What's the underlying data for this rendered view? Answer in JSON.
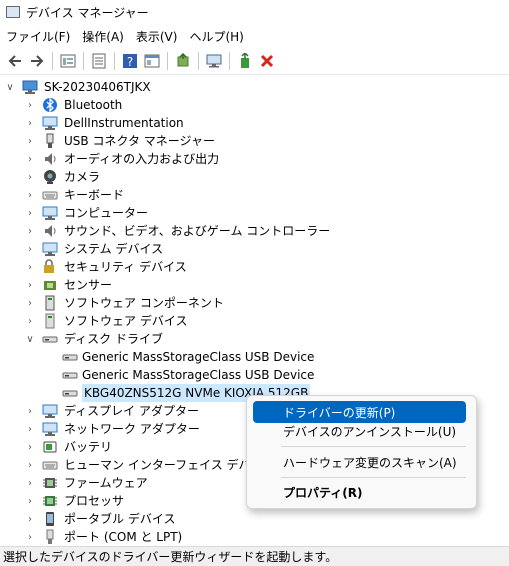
{
  "window": {
    "title": "デバイス マネージャー"
  },
  "menu": [
    "ファイル(F)",
    "操作(A)",
    "表示(V)",
    "ヘルプ(H)"
  ],
  "toolbar": [
    "back-icon",
    "forward-icon",
    "properties-grid-icon",
    "show-hide-icon",
    "help-icon",
    "view-icon",
    "update-driver-icon",
    "scan-hardware-icon",
    "enable-device-icon",
    "uninstall-icon"
  ],
  "tree": {
    "root": "SK-20230406TJKX",
    "items": [
      {
        "label": "Bluetooth",
        "icon": "bluetooth-icon",
        "color": "#1e6fd9"
      },
      {
        "label": "DellInstrumentation",
        "icon": "monitor-icon",
        "color": "#2b7ac8"
      },
      {
        "label": "USB コネクタ マネージャー",
        "icon": "usb-icon",
        "color": "#555555"
      },
      {
        "label": "オーディオの入力および出力",
        "icon": "speaker-icon",
        "color": "#6a6a6a"
      },
      {
        "label": "カメラ",
        "icon": "camera-icon",
        "color": "#444444"
      },
      {
        "label": "キーボード",
        "icon": "keyboard-icon",
        "color": "#7a7a7a"
      },
      {
        "label": "コンピューター",
        "icon": "computer-icon",
        "color": "#2b7ac8"
      },
      {
        "label": "サウンド、ビデオ、およびゲーム コントローラー",
        "icon": "sound-icon",
        "color": "#6a6a6a"
      },
      {
        "label": "システム デバイス",
        "icon": "system-icon",
        "color": "#3a7ebf"
      },
      {
        "label": "セキュリティ デバイス",
        "icon": "security-icon",
        "color": "#c9a227"
      },
      {
        "label": "センサー",
        "icon": "sensor-icon",
        "color": "#5a8a3a"
      },
      {
        "label": "ソフトウェア コンポーネント",
        "icon": "software-component-icon",
        "color": "#555555"
      },
      {
        "label": "ソフトウェア デバイス",
        "icon": "software-device-icon",
        "color": "#777777"
      },
      {
        "label": "ディスク ドライブ",
        "icon": "disk-drive-icon",
        "color": "#666666",
        "expanded": true
      },
      {
        "label": "Generic MassStorageClass USB Device",
        "icon": "drive-icon",
        "color": "#666666",
        "child": true
      },
      {
        "label": "Generic MassStorageClass USB Device",
        "icon": "drive-icon",
        "color": "#666666",
        "child": true
      },
      {
        "label": "KBG40ZNS512G NVMe KIOXIA 512GB",
        "icon": "drive-icon",
        "color": "#666666",
        "child": true,
        "selected": true
      },
      {
        "label": "ディスプレイ アダプター",
        "icon": "display-adapter-icon",
        "color": "#2b7ac8"
      },
      {
        "label": "ネットワーク アダプター",
        "icon": "network-icon",
        "color": "#2b7ac8"
      },
      {
        "label": "バッテリ",
        "icon": "battery-icon",
        "color": "#3a9a3a"
      },
      {
        "label": "ヒューマン インターフェイス デバイス",
        "icon": "hid-icon",
        "color": "#777777"
      },
      {
        "label": "ファームウェア",
        "icon": "firmware-icon",
        "color": "#555555"
      },
      {
        "label": "プロセッサ",
        "icon": "processor-icon",
        "color": "#3a7a3a"
      },
      {
        "label": "ポータブル デバイス",
        "icon": "portable-device-icon",
        "color": "#444444"
      },
      {
        "label": "ポート (COM と LPT)",
        "icon": "port-icon",
        "color": "#777777"
      }
    ]
  },
  "context_menu": {
    "items": [
      "ドライバーの更新(P)",
      "デバイスのアンインストール(U)",
      "ハードウェア変更のスキャン(A)",
      "プロパティ(R)"
    ]
  },
  "status": "選択したデバイスのドライバー更新ウィザードを起動します。"
}
